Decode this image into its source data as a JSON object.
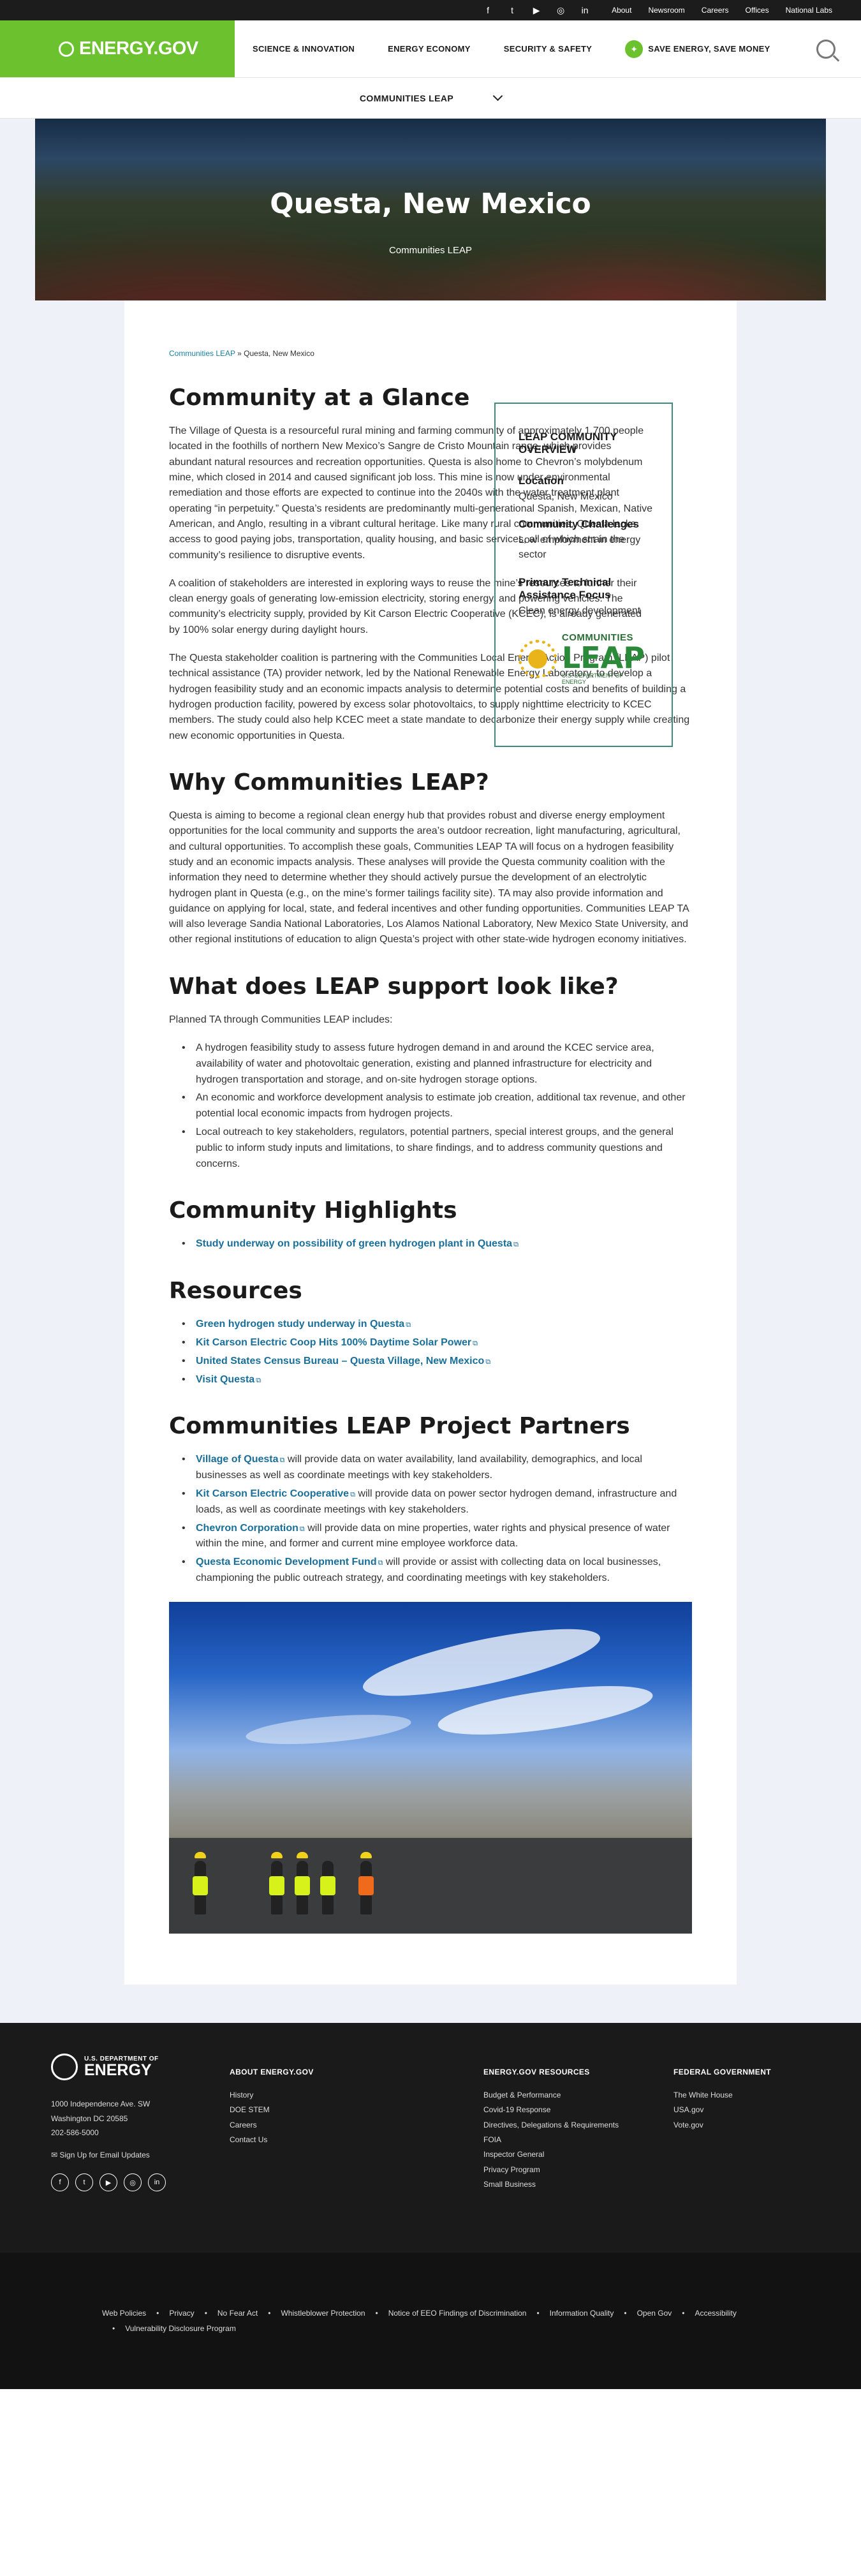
{
  "utility_bar": {
    "social": [
      "facebook-icon",
      "twitter-icon",
      "youtube-icon",
      "instagram-icon",
      "linkedin-icon"
    ],
    "social_glyphs": [
      "f",
      "t",
      "▶",
      "◎",
      "in"
    ],
    "links": [
      "About",
      "Newsroom",
      "Careers",
      "Offices",
      "National Labs"
    ]
  },
  "header": {
    "logo": "ENERGY.GOV",
    "nav": [
      "SCIENCE & INNOVATION",
      "ENERGY ECONOMY",
      "SECURITY & SAFETY"
    ],
    "save_energy": "SAVE ENERGY, SAVE MONEY"
  },
  "sub_nav": {
    "title": "COMMUNITIES LEAP"
  },
  "hero": {
    "title": "Questa, New Mexico",
    "subtitle": "Communities LEAP"
  },
  "breadcrumb": {
    "link": "Communities LEAP",
    "separator": " » ",
    "current": "Questa, New Mexico"
  },
  "glance": {
    "title": "Community at a Glance",
    "paragraphs": [
      "The Village of Questa is a resourceful rural mining and farming community of approximately 1,700 people located in the foothills of northern New Mexico’s Sangre de Cristo Mountain range, which provides abundant natural resources and recreation opportunities. Questa is also home to Chevron’s molybdenum mine, which closed in 2014 and caused significant job loss. This mine is now under environmental remediation and those efforts are expected to continue into the 2040s with the water treatment plant operating “in perpetuity.” Questa’s residents are predominantly multi-generational Spanish, Mexican, Native American, and Anglo, resulting in a vibrant cultural heritage. Like many rural communities, Questa lacks access to good paying jobs, transportation, quality housing, and basic services, all of which strain the community’s resilience to disruptive events.",
      "A coalition of stakeholders are interested in exploring ways to reuse the mine’s resources to further their clean energy goals of generating low-emission electricity, storing energy, and powering vehicles. The community’s electricity supply, provided by Kit Carson Electric Cooperative (KCEC), is already generated by 100% solar energy during daylight hours."
    ],
    "paragraph_full": "The Questa stakeholder coalition is partnering with the Communities Local Energy Action Program (LEAP) pilot technical assistance (TA) provider network, led by the National Renewable Energy Laboratory, to develop a hydrogen feasibility study and an economic impacts analysis to determine potential costs and benefits of building a hydrogen production facility, powered by excess solar photovoltaics, to supply nighttime electricity to KCEC members. The study could also help KCEC meet a state mandate to decarbonize their energy supply while creating new economic opportunities in Questa."
  },
  "overview": {
    "heading": "LEAP COMMUNITY OVERVIEW",
    "location_label": "Location",
    "location_value": "Questa, New Mexico",
    "challenges_label": "Community Challenges",
    "challenges_value": "Low employment in energy sector",
    "focus_label": "Primary Technical Assistance Focus",
    "focus_value": "Clean energy development",
    "logo_line1": "COMMUNITIES",
    "logo_line2": "LEAP",
    "logo_line3": "U.S. DEPARTMENT OF ENERGY"
  },
  "why": {
    "title": "Why Communities LEAP?",
    "paragraph": "Questa is aiming to become a regional clean energy hub that provides robust and diverse energy employment opportunities for the local community and supports the area’s outdoor recreation, light manufacturing, agricultural, and cultural opportunities. To accomplish these goals, Communities LEAP TA will focus on a hydrogen feasibility study and an economic impacts analysis. These analyses will provide the Questa community coalition with the information they need to determine whether they should actively pursue the development of an electrolytic hydrogen plant in Questa (e.g., on the mine’s former tailings facility site). TA may also provide information and guidance on applying for local, state, and federal incentives and other funding opportunities. Communities LEAP TA will also leverage Sandia National Laboratories, Los Alamos National Laboratory, New Mexico State University, and other regional institutions of education to align Questa’s project with other state-wide hydrogen economy initiatives."
  },
  "support": {
    "title": "What does LEAP support look like?",
    "intro": "Planned TA through Communities LEAP includes:",
    "items": [
      "A hydrogen feasibility study to assess future hydrogen demand in and around the KCEC service area, availability of water and photovoltaic generation, existing and planned infrastructure for electricity and hydrogen transportation and storage, and on-site hydrogen storage options.",
      "An economic and workforce development analysis to estimate job creation, additional tax revenue, and other potential local economic impacts from hydrogen projects.",
      "Local outreach to key stakeholders, regulators, potential partners, special interest groups, and the general public to inform study inputs and limitations, to share findings, and to address community questions and concerns."
    ]
  },
  "highlights": {
    "title": "Community Highlights",
    "items": [
      "Study underway on possibility of green hydrogen plant in Questa"
    ]
  },
  "resources": {
    "title": "Resources",
    "items": [
      "Green hydrogen study underway in Questa",
      "Kit Carson Electric Coop Hits 100% Daytime Solar Power",
      "United States Census Bureau – Questa Village, New Mexico",
      "Visit Questa"
    ]
  },
  "partners": {
    "title": "Communities LEAP Project Partners",
    "items": [
      {
        "name": "Village of Questa",
        "text": " will provide data on water availability, land availability, demographics, and local businesses as well as coordinate meetings with key stakeholders."
      },
      {
        "name": "Kit Carson Electric Cooperative",
        "text": " will provide data on power sector hydrogen demand, infrastructure and loads, as well as coordinate meetings with key stakeholders."
      },
      {
        "name": "Chevron Corporation",
        "text": " will provide data on mine properties, water rights and physical presence of water within the mine, and former and current mine employee workforce data."
      },
      {
        "name": "Questa Economic Development Fund",
        "text": " will provide or assist with collecting data on local businesses, championing the public outreach strategy, and coordinating meetings with key stakeholders."
      }
    ]
  },
  "footer": {
    "brand_line1": "U.S. DEPARTMENT OF",
    "brand_line2": "ENERGY",
    "address": [
      "1000 Independence Ave. SW",
      "Washington DC 20585",
      "202-586-5000"
    ],
    "signup": "Sign Up for Email Updates",
    "social": [
      "f",
      "t",
      "▶",
      "◎",
      "in"
    ],
    "about_head": "ABOUT ENERGY.GOV",
    "about_links": [
      "History",
      "DOE STEM",
      "Careers",
      "Contact Us"
    ],
    "resources_head": "ENERGY.GOV RESOURCES",
    "resources_links": [
      "Budget & Performance",
      "Covid-19 Response",
      "Directives, Delegations & Requirements",
      "FOIA",
      "Inspector General",
      "Privacy Program",
      "Small Business"
    ],
    "federal_head": "FEDERAL GOVERNMENT",
    "federal_links": [
      "The White House",
      "USA.gov",
      "Vote.gov"
    ]
  },
  "footer_bottom": {
    "links": [
      "Web Policies",
      "Privacy",
      "No Fear Act",
      "Whistleblower Protection",
      "Notice of EEO Findings of Discrimination",
      "Information Quality",
      "Open Gov",
      "Accessibility",
      "Vulnerability Disclosure Program"
    ]
  },
  "colors": {
    "brand_green": "#6cc22e",
    "link_blue": "#1a6f9a",
    "box_border": "#3e8a7e",
    "footer_bg": "#1a1a1a"
  }
}
